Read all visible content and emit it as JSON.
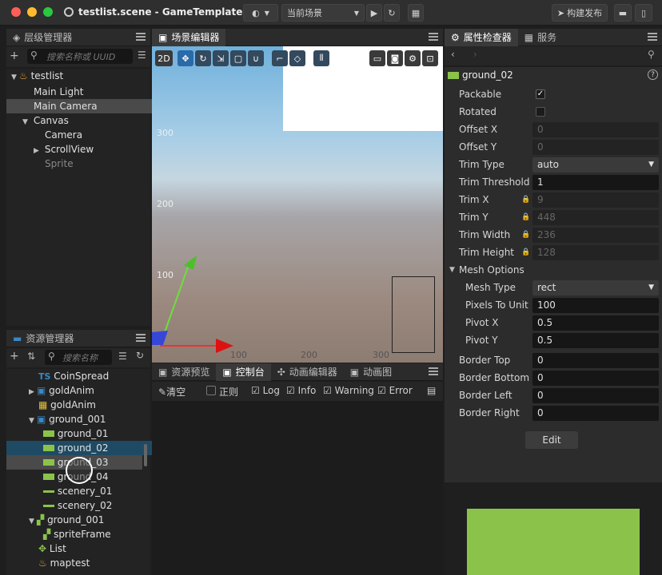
{
  "window": {
    "title": "testlist.scene - GameTemplate",
    "current_scene": "当前场景",
    "build_label": "构建发布"
  },
  "hierarchy": {
    "title": "层级管理器",
    "search_placeholder": "搜索名称或 UUID",
    "items": [
      {
        "label": "testlist"
      },
      {
        "label": "Main Light"
      },
      {
        "label": "Main Camera"
      },
      {
        "label": "Canvas"
      },
      {
        "label": "Camera"
      },
      {
        "label": "ScrollView"
      },
      {
        "label": "Sprite"
      }
    ]
  },
  "scene": {
    "tab": "场景编辑器",
    "mode_2d": "2D",
    "y_ticks": [
      "300",
      "200",
      "100"
    ],
    "x_ticks": [
      "100",
      "200",
      "300"
    ]
  },
  "assets": {
    "title": "资源管理器",
    "search_placeholder": "搜索名称",
    "items": [
      {
        "label": "CoinSpread",
        "prefix": "TS"
      },
      {
        "label": "goldAnim"
      },
      {
        "label": "goldAnim"
      },
      {
        "label": "ground_001"
      },
      {
        "label": "ground_01"
      },
      {
        "label": "ground_02"
      },
      {
        "label": "ground_03"
      },
      {
        "label": "ground_04"
      },
      {
        "label": "scenery_01"
      },
      {
        "label": "scenery_02"
      },
      {
        "label": "ground_001"
      },
      {
        "label": "spriteFrame"
      },
      {
        "label": "List"
      },
      {
        "label": "maptest"
      }
    ]
  },
  "console": {
    "tabs": [
      "资源预览",
      "控制台",
      "动画编辑器",
      "动画图"
    ],
    "clear": "清空",
    "regex": "正则",
    "filters": [
      "Log",
      "Info",
      "Warning",
      "Error"
    ]
  },
  "inspector": {
    "tabs": [
      "属性检查器",
      "服务"
    ],
    "asset_name": "ground_02",
    "packable": "Packable",
    "rotated": "Rotated",
    "rows": [
      {
        "label": "Offset X",
        "value": "0"
      },
      {
        "label": "Offset Y",
        "value": "0"
      },
      {
        "label": "Trim Type",
        "value": "auto"
      },
      {
        "label": "Trim Threshold",
        "value": "1"
      },
      {
        "label": "Trim X",
        "value": "9"
      },
      {
        "label": "Trim Y",
        "value": "448"
      },
      {
        "label": "Trim Width",
        "value": "236"
      },
      {
        "label": "Trim Height",
        "value": "128"
      }
    ],
    "mesh_options": "Mesh Options",
    "mesh_rows": [
      {
        "label": "Mesh Type",
        "value": "rect"
      },
      {
        "label": "Pixels To Unit",
        "value": "100"
      },
      {
        "label": "Pivot X",
        "value": "0.5"
      },
      {
        "label": "Pivot Y",
        "value": "0.5"
      }
    ],
    "border_rows": [
      {
        "label": "Border Top",
        "value": "0"
      },
      {
        "label": "Border Bottom",
        "value": "0"
      },
      {
        "label": "Border Left",
        "value": "0"
      },
      {
        "label": "Border Right",
        "value": "0"
      }
    ],
    "edit": "Edit"
  },
  "colors": {
    "accent": "#3a88c4",
    "sprite_green": "#8bc34a",
    "selection": "#1f4a63"
  }
}
